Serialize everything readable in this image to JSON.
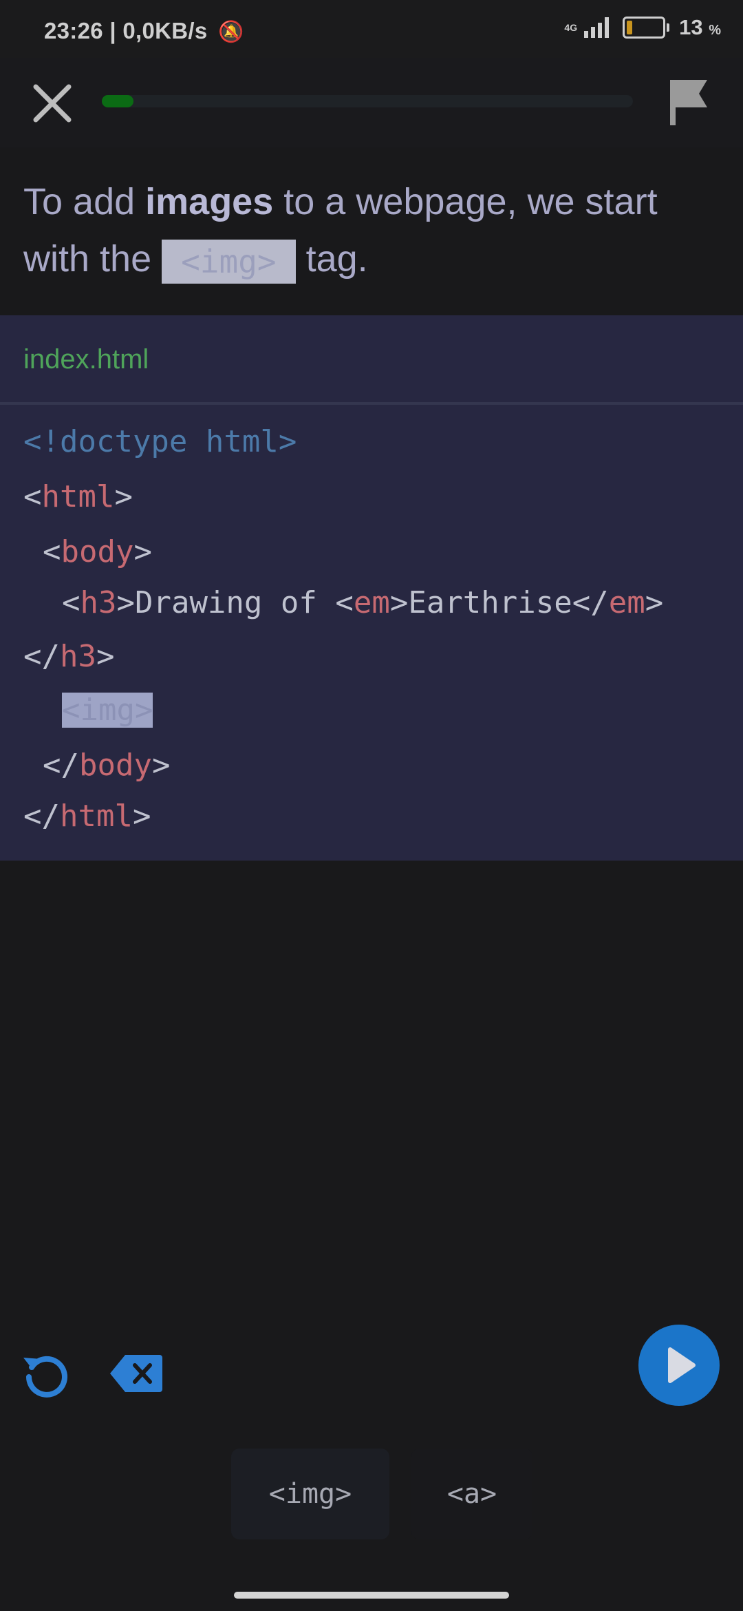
{
  "status_bar": {
    "time_and_speed": "23:26 | 0,0KB/s",
    "network": "4G",
    "battery_percent": "13",
    "battery_unit": "%",
    "battery_level": 0.13
  },
  "lesson": {
    "progress_fraction": 0.06,
    "instruction": {
      "part1": "To add ",
      "bold": "images",
      "part2": " to a webpage, we start with the ",
      "code": "<img>",
      "part3": " tag."
    }
  },
  "editor": {
    "file_name": "index.html",
    "lines": {
      "l1": "<!doctype html>",
      "l2_lt": "<",
      "l2_tag": "html",
      "l2_gt": ">",
      "l3_lt": "<",
      "l3_tag": "body",
      "l3_gt": ">",
      "l4_lt": "<",
      "l4_tag": "h3",
      "l4_mid1": ">Drawing of <",
      "l4_em": "em",
      "l4_mid2": ">Earthrise</",
      "l4_em2": "em",
      "l4_gt": ">",
      "l5_lt": "</",
      "l5_tag": "h3",
      "l5_gt": ">",
      "l6_placeholder": "<img>",
      "l7_lt": "</",
      "l7_tag": "body",
      "l7_gt": ">",
      "l8_lt": "</",
      "l8_tag": "html",
      "l8_gt": ">"
    }
  },
  "answer_chips": [
    {
      "label": "<img>"
    },
    {
      "label": "<a>"
    }
  ],
  "colors": {
    "run_button": "#1b75c9",
    "progress_fill": "#0b6b14",
    "file_name": "#4fa45a"
  }
}
